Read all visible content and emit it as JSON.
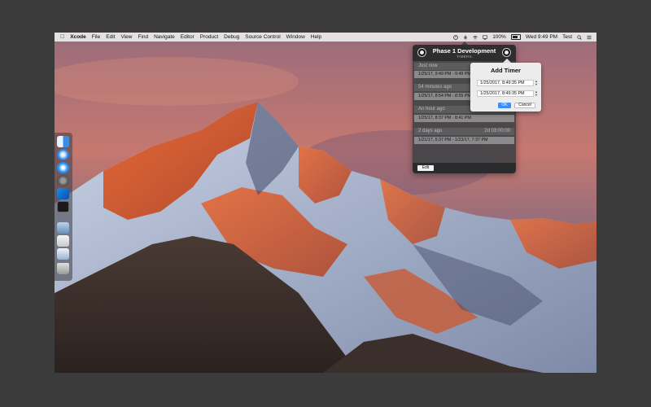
{
  "menubar": {
    "apple_icon": "apple-logo-icon",
    "app_name": "Xcode",
    "menus": [
      "File",
      "Edit",
      "View",
      "Find",
      "Navigate",
      "Editor",
      "Product",
      "Debug",
      "Source Control",
      "Window",
      "Help"
    ],
    "battery_percent": "100%",
    "datetime": "Wed 9:49 PM",
    "user": "Test"
  },
  "popover": {
    "title": "Phase 1 Development",
    "subtitle": "TIMERS",
    "groups": [
      {
        "label": "Just now",
        "duration": "",
        "entry": "1/25/17, 9:49 PM - 9:49 PM"
      },
      {
        "label": "54 minutes ago",
        "duration": "",
        "entry": "1/25/17, 8:54 PM - 8:55 PM"
      },
      {
        "label": "An hour ago",
        "duration": "",
        "entry": "1/25/17, 8:37 PM - 8:41 PM"
      },
      {
        "label": "2 days ago",
        "duration": "2d 03:00:00",
        "entry": "1/21/17, 5:37 PM - 1/23/17, 7:37 PM"
      }
    ],
    "edit_label": "Edit"
  },
  "add_timer": {
    "title": "Add Timer",
    "start_value": "1/25/2017,   8:49:35 PM",
    "end_value": "1/25/2017,   8:49:35 PM",
    "stepper_up": "▲",
    "stepper_down": "▼",
    "ok_label": "OK",
    "cancel_label": "Cancel"
  },
  "colors": {
    "ok_button": "#3e8ef7",
    "popover_bg": "#464648",
    "row_bg": "#8a8a8c"
  }
}
